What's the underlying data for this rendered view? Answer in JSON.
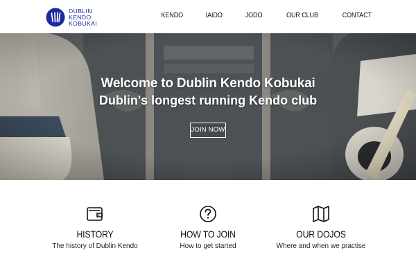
{
  "brand": {
    "logo_lines": [
      "DUBLIN",
      "KENDO",
      "KOBUKAI"
    ],
    "accent_color": "#1c2b9e",
    "icon": "club-emblem-icon"
  },
  "nav": {
    "items": [
      {
        "label": "KENDO"
      },
      {
        "label": "IAIDO"
      },
      {
        "label": "JODO"
      },
      {
        "label": "OUR CLUB"
      },
      {
        "label": "CONTACT"
      }
    ]
  },
  "hero": {
    "title": "Welcome to Dublin Kendo Kobukai",
    "subtitle": "Dublin's longest running Kendo club",
    "cta_label": "JOIN NOW"
  },
  "features": [
    {
      "icon": "wallet-icon",
      "title": "HISTORY",
      "description": "The history of Dublin Kendo"
    },
    {
      "icon": "question-circle-icon",
      "title": "HOW TO JOIN",
      "description": "How to get started"
    },
    {
      "icon": "map-icon",
      "title": "OUR DOJOS",
      "description": "Where and when we practise"
    }
  ]
}
